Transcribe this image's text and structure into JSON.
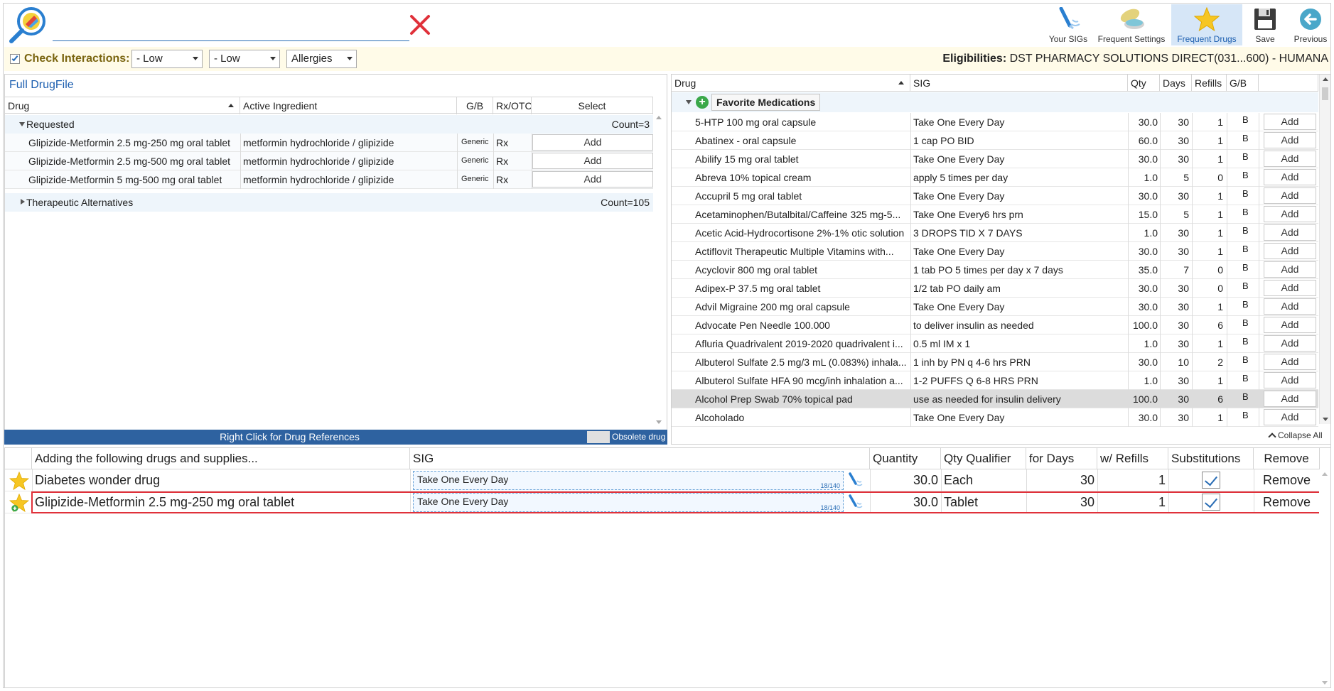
{
  "search": {
    "value": "",
    "clear_icon": "close-icon"
  },
  "toolbar": {
    "your_sigs": "Your SIGs",
    "frequent_settings": "Frequent Settings",
    "frequent_drugs": "Frequent Drugs",
    "save": "Save",
    "previous": "Previous"
  },
  "interactions": {
    "label": "Check Interactions:",
    "combo1": "- Low",
    "combo2": "- Low",
    "combo3": "Allergies",
    "eligibilities_label": "Eligibilities:",
    "eligibilities_value": "DST PHARMACY SOLUTIONS DIRECT(031...600) - HUMANA"
  },
  "left": {
    "title": "Full DrugFile",
    "headers": {
      "drug": "Drug",
      "ingredient": "Active Ingredient",
      "gb": "G/B",
      "rxotc": "Rx/OTC",
      "select": "Select"
    },
    "requested_group": "Requested",
    "requested_count": "Count=3",
    "rows": [
      {
        "drug": "Glipizide-Metformin 2.5 mg-250 mg oral tablet",
        "ingredient": "metformin hydrochloride / glipizide",
        "gb": "Generic",
        "rx": "Rx",
        "btn": "Add"
      },
      {
        "drug": "Glipizide-Metformin 2.5 mg-500 mg oral tablet",
        "ingredient": "metformin hydrochloride / glipizide",
        "gb": "Generic",
        "rx": "Rx",
        "btn": "Add"
      },
      {
        "drug": "Glipizide-Metformin 5 mg-500 mg oral tablet",
        "ingredient": "metformin hydrochloride / glipizide",
        "gb": "Generic",
        "rx": "Rx",
        "btn": "Add"
      }
    ],
    "alt_group": "Therapeutic Alternatives",
    "alt_count": "Count=105",
    "footer": "Right Click for Drug References",
    "obsolete": "Obsolete drug"
  },
  "right": {
    "headers": {
      "drug": "Drug",
      "sig": "SIG",
      "qty": "Qty",
      "days": "Days",
      "refills": "Refills",
      "gb": "G/B"
    },
    "group": "Favorite Medications",
    "rows": [
      {
        "drug": "5-HTP 100 mg oral capsule",
        "sig": "Take One Every Day",
        "qty": "30.0",
        "days": "30",
        "refills": "1",
        "gb": "B",
        "btn": "Add"
      },
      {
        "drug": "Abatinex - oral capsule",
        "sig": "1 cap PO BID",
        "qty": "60.0",
        "days": "30",
        "refills": "1",
        "gb": "B",
        "btn": "Add"
      },
      {
        "drug": "Abilify 15 mg oral tablet",
        "sig": "Take One Every Day",
        "qty": "30.0",
        "days": "30",
        "refills": "1",
        "gb": "B",
        "btn": "Add"
      },
      {
        "drug": "Abreva 10% topical cream",
        "sig": "apply 5 times per day",
        "qty": "1.0",
        "days": "5",
        "refills": "0",
        "gb": "B",
        "btn": "Add"
      },
      {
        "drug": "Accupril 5 mg oral tablet",
        "sig": "Take One Every Day",
        "qty": "30.0",
        "days": "30",
        "refills": "1",
        "gb": "B",
        "btn": "Add"
      },
      {
        "drug": "Acetaminophen/Butalbital/Caffeine 325 mg-5...",
        "sig": "Take One Every6 hrs prn",
        "qty": "15.0",
        "days": "5",
        "refills": "1",
        "gb": "B",
        "btn": "Add"
      },
      {
        "drug": "Acetic Acid-Hydrocortisone 2%-1% otic solution",
        "sig": "3 DROPS TID X 7 DAYS",
        "qty": "1.0",
        "days": "30",
        "refills": "1",
        "gb": "B",
        "btn": "Add"
      },
      {
        "drug": "Actiflovit Therapeutic Multiple Vitamins with...",
        "sig": "Take One Every Day",
        "qty": "30.0",
        "days": "30",
        "refills": "1",
        "gb": "B",
        "btn": "Add"
      },
      {
        "drug": "Acyclovir 800 mg oral tablet",
        "sig": "1 tab PO 5 times per day x 7 days",
        "qty": "35.0",
        "days": "7",
        "refills": "0",
        "gb": "B",
        "btn": "Add"
      },
      {
        "drug": "Adipex-P 37.5 mg oral tablet",
        "sig": "1/2 tab PO daily am",
        "qty": "30.0",
        "days": "30",
        "refills": "0",
        "gb": "B",
        "btn": "Add"
      },
      {
        "drug": "Advil Migraine 200 mg oral capsule",
        "sig": "Take One Every Day",
        "qty": "30.0",
        "days": "30",
        "refills": "1",
        "gb": "B",
        "btn": "Add"
      },
      {
        "drug": "Advocate Pen Needle 100.000",
        "sig": "to deliver insulin as needed",
        "qty": "100.0",
        "days": "30",
        "refills": "6",
        "gb": "B",
        "btn": "Add"
      },
      {
        "drug": "Afluria Quadrivalent 2019-2020 quadrivalent i...",
        "sig": "0.5 ml IM x 1",
        "qty": "1.0",
        "days": "30",
        "refills": "1",
        "gb": "B",
        "btn": "Add"
      },
      {
        "drug": "Albuterol Sulfate 2.5 mg/3 mL (0.083%) inhala...",
        "sig": "1 inh by PN q 4-6 hrs PRN",
        "qty": "30.0",
        "days": "10",
        "refills": "2",
        "gb": "B",
        "btn": "Add"
      },
      {
        "drug": "Albuterol Sulfate HFA 90 mcg/inh inhalation a...",
        "sig": "1-2 PUFFS Q 6-8 HRS PRN",
        "qty": "1.0",
        "days": "30",
        "refills": "1",
        "gb": "B",
        "btn": "Add"
      },
      {
        "drug": "Alcohol Prep Swab 70% topical pad",
        "sig": "use as needed for insulin delivery",
        "qty": "100.0",
        "days": "30",
        "refills": "6",
        "gb": "B",
        "btn": "Add"
      },
      {
        "drug": "Alcoholado",
        "sig": "Take One Every Day",
        "qty": "30.0",
        "days": "30",
        "refills": "1",
        "gb": "B",
        "btn": "Add"
      }
    ],
    "collapse_all": "Collapse All"
  },
  "bottom": {
    "headers": {
      "drug": "Adding the following drugs and supplies...",
      "sig": "SIG",
      "qty": "Quantity",
      "qualifier": "Qty Qualifier",
      "days": "for Days",
      "refills": "w/ Refills",
      "subs": "Substitutions",
      "remove": "Remove"
    },
    "rows": [
      {
        "drug": "Diabetes wonder drug",
        "sig": "Take One Every Day",
        "counter": "18/140",
        "qty": "30.0",
        "qualifier": "Each",
        "days": "30",
        "refills": "1",
        "remove": "Remove"
      },
      {
        "drug": "Glipizide-Metformin 2.5 mg-250 mg oral tablet",
        "sig": "Take One Every Day",
        "counter": "18/140",
        "qty": "30.0",
        "qualifier": "Tablet",
        "days": "30",
        "refills": "1",
        "remove": "Remove"
      }
    ]
  },
  "colors": {
    "accent": "#1d5fb0",
    "footer_bar": "#2e62a0",
    "highlight_border": "#e0313a",
    "selected_row": "#dcdcdc",
    "group_bg": "#eef5fb"
  }
}
